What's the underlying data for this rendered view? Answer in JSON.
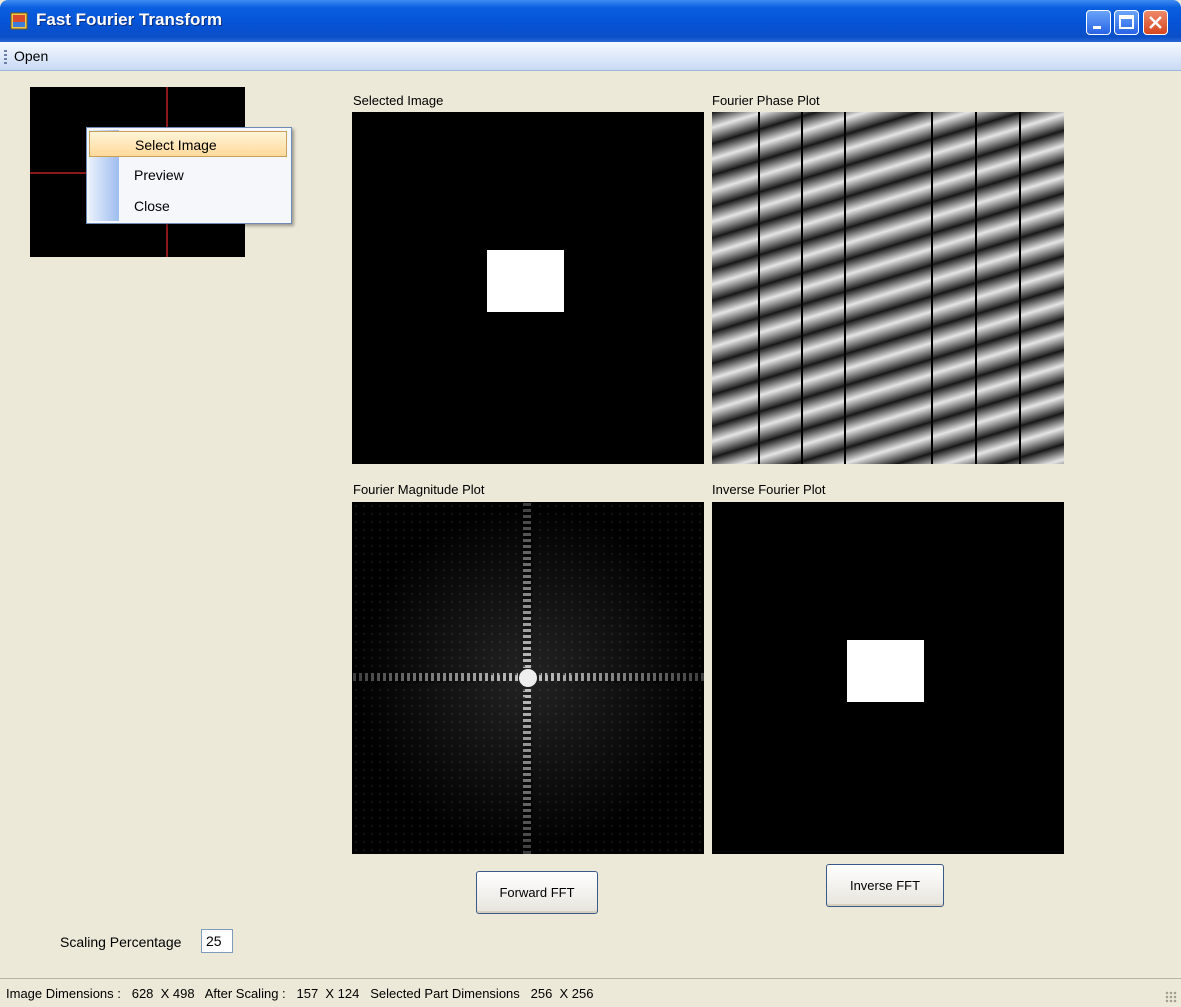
{
  "window": {
    "title": "Fast Fourier Transform"
  },
  "menu": {
    "open_label": "Open"
  },
  "context_menu": {
    "items": [
      "Select Image",
      "Preview",
      "Close"
    ],
    "highlighted_index": 0
  },
  "panels": {
    "selected": {
      "label": "Selected Image"
    },
    "phase": {
      "label": "Fourier Phase Plot"
    },
    "magnitude": {
      "label": "Fourier Magnitude Plot"
    },
    "inverse": {
      "label": "Inverse Fourier  Plot"
    }
  },
  "buttons": {
    "forward_label": "Forward FFT",
    "inverse_label": "Inverse FFT"
  },
  "scaling": {
    "label": "Scaling Percentage",
    "value": "25"
  },
  "status": {
    "text": "Image Dimensions :   628  X 498   After Scaling :   157  X 124   Selected Part Dimensions   256  X 256"
  },
  "colors": {
    "titlebar": "#0553d6",
    "canvas_bg": "#000000",
    "highlight": "#ffd99a"
  }
}
